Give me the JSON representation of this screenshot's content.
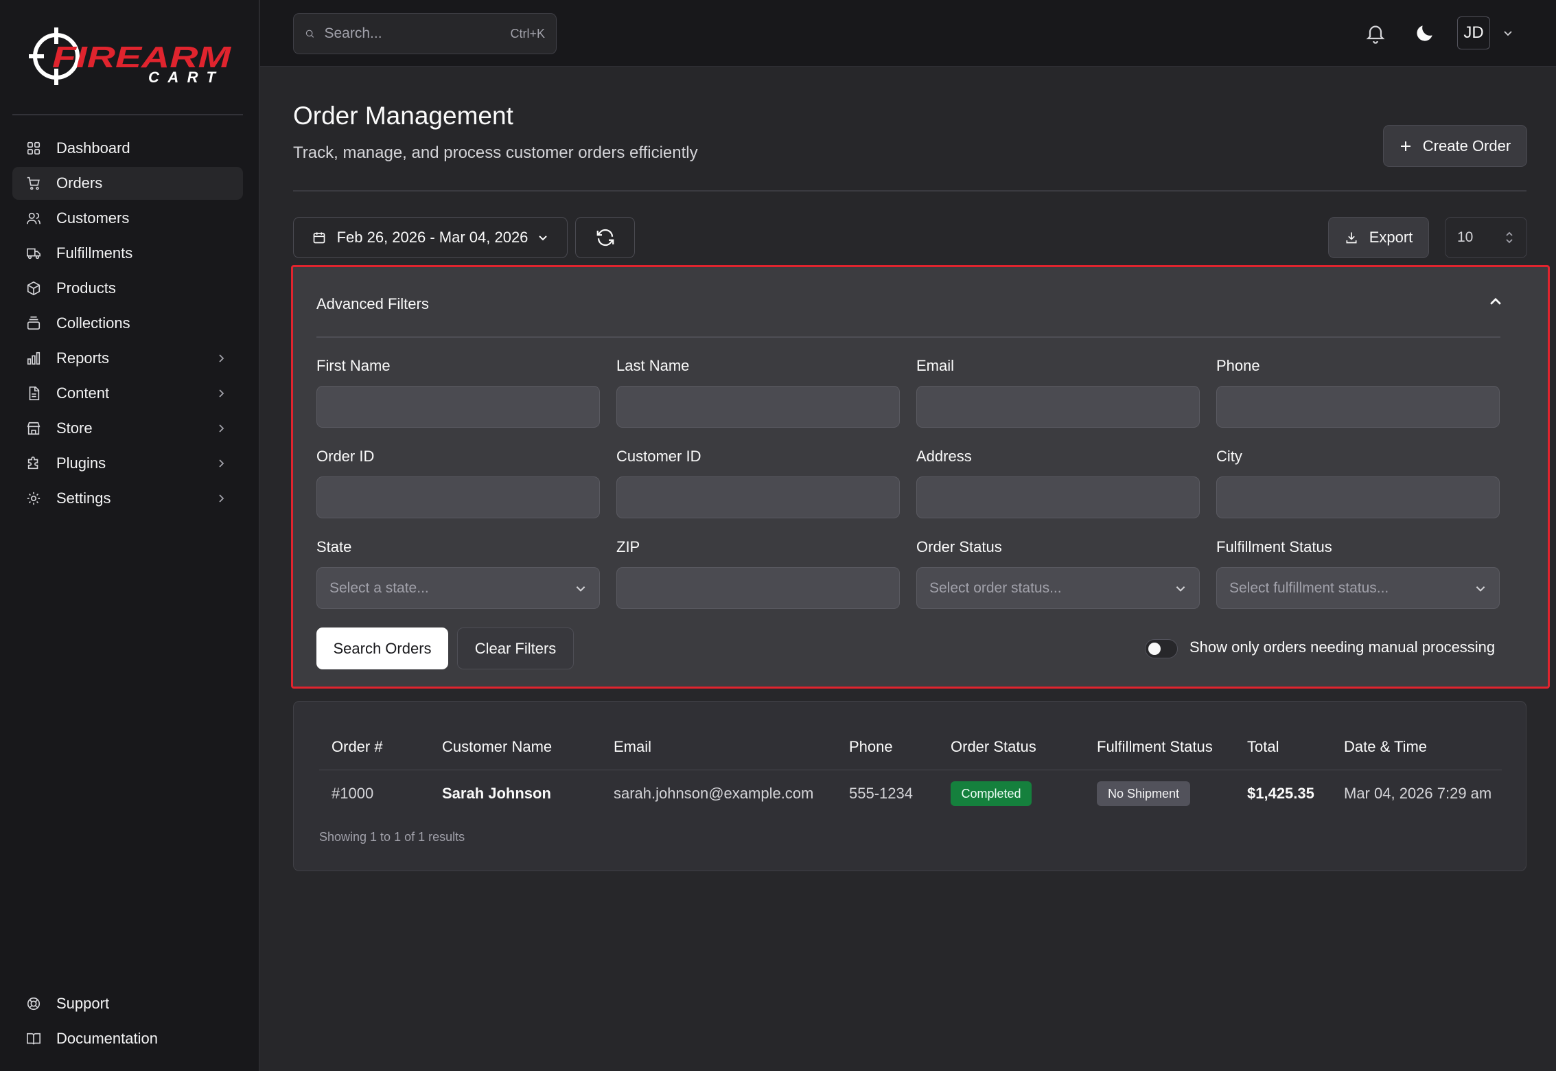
{
  "brand": {
    "logo_main": "FIREARM",
    "logo_sub": "CART",
    "accent": "#e0242e"
  },
  "sidebar": {
    "items": [
      {
        "label": "Dashboard",
        "icon": "dashboard-icon",
        "active": false
      },
      {
        "label": "Orders",
        "icon": "cart-icon",
        "active": true
      },
      {
        "label": "Customers",
        "icon": "users-icon",
        "active": false
      },
      {
        "label": "Fulfillments",
        "icon": "truck-icon",
        "active": false
      },
      {
        "label": "Products",
        "icon": "box-icon",
        "active": false
      },
      {
        "label": "Collections",
        "icon": "collections-icon",
        "active": false
      },
      {
        "label": "Reports",
        "icon": "bar-chart-icon",
        "expandable": true
      },
      {
        "label": "Content",
        "icon": "file-icon",
        "expandable": true
      },
      {
        "label": "Store",
        "icon": "store-icon",
        "expandable": true
      },
      {
        "label": "Plugins",
        "icon": "puzzle-icon",
        "expandable": true
      },
      {
        "label": "Settings",
        "icon": "gear-icon",
        "expandable": true
      }
    ],
    "bottom": [
      {
        "label": "Support",
        "icon": "lifebuoy-icon"
      },
      {
        "label": "Documentation",
        "icon": "book-icon"
      }
    ]
  },
  "header": {
    "search_placeholder": "Search...",
    "search_shortcut": "Ctrl+K",
    "avatar_initials": "JD"
  },
  "page": {
    "title": "Order Management",
    "subtitle": "Track, manage, and process customer orders efficiently",
    "create_label": "Create Order"
  },
  "toolbar": {
    "date_range": "Feb 26, 2026 - Mar 04, 2026",
    "export_label": "Export",
    "per_page": "10"
  },
  "filters": {
    "title": "Advanced Filters",
    "labels": {
      "first_name": "First Name",
      "last_name": "Last Name",
      "email": "Email",
      "phone": "Phone",
      "order_id": "Order ID",
      "customer_id": "Customer ID",
      "address": "Address",
      "city": "City",
      "state": "State",
      "zip": "ZIP",
      "order_status": "Order Status",
      "fulfillment_status": "Fulfillment Status"
    },
    "state_placeholder": "Select a state...",
    "order_status_placeholder": "Select order status...",
    "fulfillment_status_placeholder": "Select fulfillment status...",
    "search_label": "Search Orders",
    "clear_label": "Clear Filters",
    "manual_toggle_label": "Show only orders needing manual processing",
    "manual_toggle_on": false
  },
  "orders": {
    "columns": [
      "Order #",
      "Customer Name",
      "Email",
      "Phone",
      "Order Status",
      "Fulfillment Status",
      "Total",
      "Date & Time"
    ],
    "rows": [
      {
        "order_no": "#1000",
        "customer": "Sarah Johnson",
        "email": "sarah.johnson@example.com",
        "phone": "555-1234",
        "order_status": "Completed",
        "fulfillment_status": "No Shipment",
        "total": "$1,425.35",
        "datetime": "Mar 04, 2026 7:29 am"
      }
    ],
    "summary": "Showing 1 to 1 of 1 results"
  }
}
